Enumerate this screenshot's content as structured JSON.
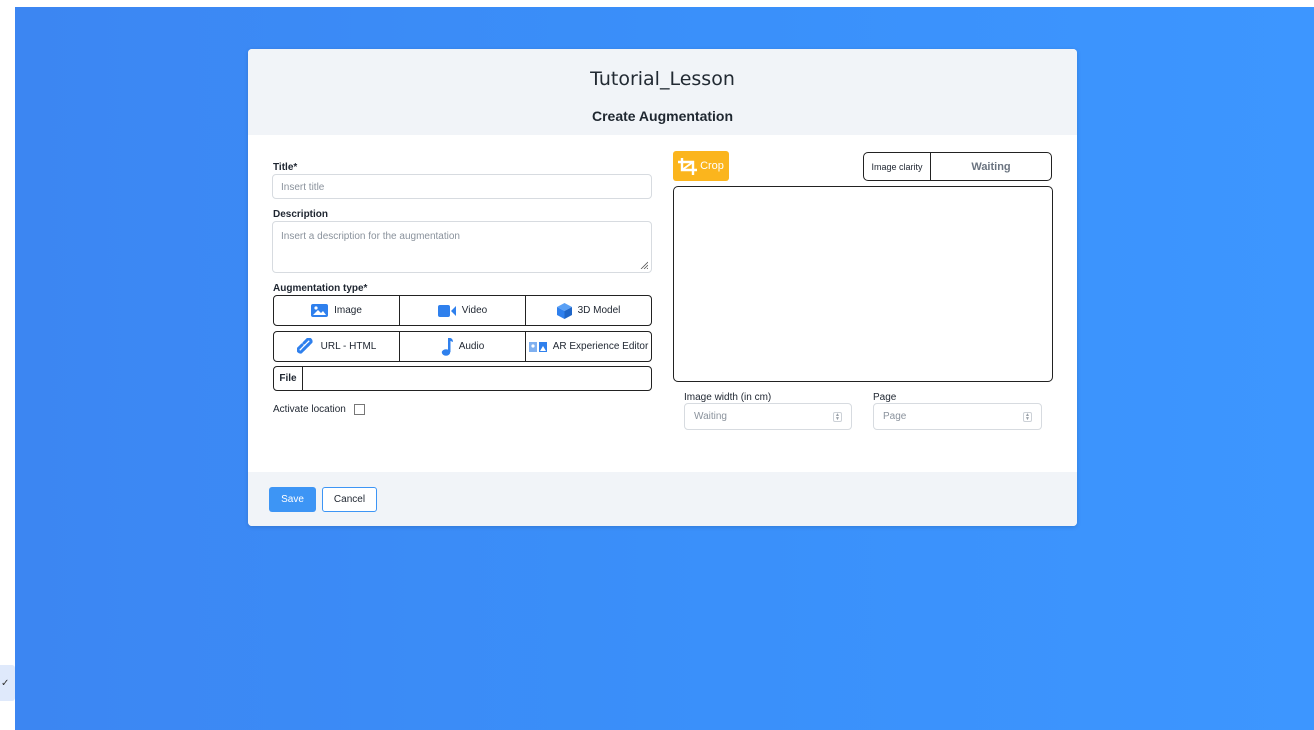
{
  "header": {
    "lesson_title": "Tutorial_Lesson",
    "subtitle": "Create Augmentation"
  },
  "form": {
    "title_label": "Title*",
    "title_placeholder": "Insert title",
    "description_label": "Description",
    "description_placeholder": "Insert a description for the augmentation",
    "type_label": "Augmentation type*",
    "types_row1": [
      {
        "label": "Image",
        "icon": "image-icon"
      },
      {
        "label": "Video",
        "icon": "video-icon"
      },
      {
        "label": "3D Model",
        "icon": "cube-icon"
      }
    ],
    "types_row2": [
      {
        "label": "URL - HTML",
        "icon": "link-icon"
      },
      {
        "label": "Audio",
        "icon": "music-note-icon"
      },
      {
        "label": "AR Experience Editor",
        "icon": "ar-editor-icon"
      }
    ],
    "file_label": "File",
    "activate_location_label": "Activate location"
  },
  "right": {
    "crop_label": "Crop",
    "clarity_label": "Image clarity",
    "clarity_value": "Waiting",
    "width_label": "Image width (in cm)",
    "width_placeholder": "Waiting",
    "page_label": "Page",
    "page_placeholder": "Page"
  },
  "footer": {
    "save_label": "Save",
    "cancel_label": "Cancel"
  },
  "side_tab": {
    "glyph": "✓"
  },
  "colors": {
    "background": "#3a8ef8",
    "crop_button": "#fbb51d",
    "save_button": "#3d95f5",
    "icon_blue": "#2f80ed"
  }
}
